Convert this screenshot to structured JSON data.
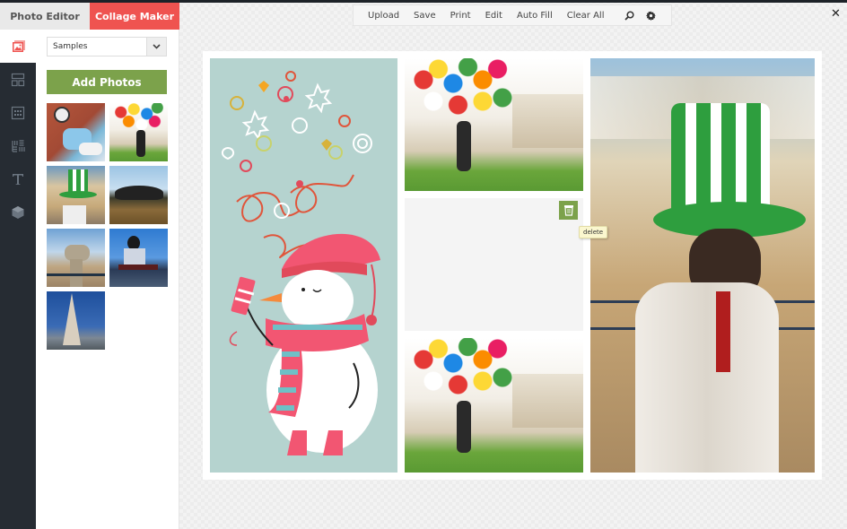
{
  "mode_tabs": [
    {
      "label": "Photo Editor",
      "active": false
    },
    {
      "label": "Collage Maker",
      "active": true
    }
  ],
  "rail": [
    {
      "name": "photos-icon",
      "active": true
    },
    {
      "name": "layout-icon",
      "active": false
    },
    {
      "name": "grid-icon",
      "active": false
    },
    {
      "name": "pattern-icon",
      "active": false
    },
    {
      "name": "text-icon",
      "active": false
    },
    {
      "name": "sticker-icon",
      "active": false
    }
  ],
  "panel": {
    "source_select": {
      "value": "Samples"
    },
    "add_photos_label": "Add Photos",
    "thumbnails": [
      {
        "name": "motorcycle-photo"
      },
      {
        "name": "balloons-photo"
      },
      {
        "name": "top-hat-photo"
      },
      {
        "name": "trees-photo"
      },
      {
        "name": "binoculars-photo"
      },
      {
        "name": "keyboardist-photo"
      },
      {
        "name": "pyramid-tower-photo"
      }
    ]
  },
  "toolbar": {
    "buttons": [
      "Upload",
      "Save",
      "Print",
      "Edit",
      "Auto Fill",
      "Clear All"
    ],
    "icons": [
      "search-icon",
      "gear-icon"
    ]
  },
  "close_label": "✕",
  "collage": {
    "tooltip": "delete"
  },
  "colors": {
    "accent_red": "#ef5350",
    "accent_green": "#7ca24b",
    "rail_bg": "#262c33"
  }
}
